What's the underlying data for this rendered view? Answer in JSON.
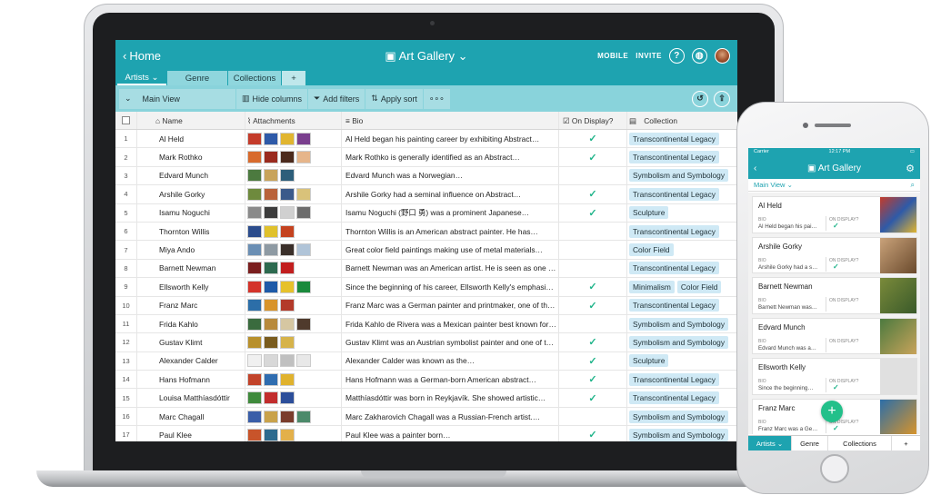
{
  "desktop": {
    "home_label": "Home",
    "app_title": "Art Gallery",
    "mobile_label": "MOBILE",
    "invite_label": "INVITE",
    "tabs": [
      "Artists",
      "Genre",
      "Collections"
    ],
    "toolbar": {
      "view_label": "Main View",
      "hide_columns": "Hide columns",
      "add_filters": "Add filters",
      "apply_sort": "Apply sort"
    },
    "columns": [
      "Name",
      "Attachments",
      "Bio",
      "On Display?",
      "Collection"
    ],
    "rows": [
      {
        "n": "1",
        "name": "Al Held",
        "bio": "Al Held began his painting career by exhibiting Abstract…",
        "on": true,
        "tags": [
          "Transcontinental Legacy"
        ]
      },
      {
        "n": "2",
        "name": "Mark Rothko",
        "bio": "Mark Rothko is generally identified as an Abstract…",
        "on": true,
        "tags": [
          "Transcontinental Legacy"
        ]
      },
      {
        "n": "3",
        "name": "Edvard Munch",
        "bio": "Edvard Munch was a Norwegian…",
        "on": false,
        "tags": [
          "Symbolism and Symbology"
        ]
      },
      {
        "n": "4",
        "name": "Arshile Gorky",
        "bio": "Arshile Gorky had a seminal influence on Abstract…",
        "on": true,
        "tags": [
          "Transcontinental Legacy"
        ]
      },
      {
        "n": "5",
        "name": "Isamu Noguchi",
        "bio": "Isamu Noguchi (野口 勇) was a prominent Japanese…",
        "on": true,
        "tags": [
          "Sculpture"
        ]
      },
      {
        "n": "6",
        "name": "Thornton Willis",
        "bio": "Thornton Willis is an American abstract painter. He has…",
        "on": false,
        "tags": [
          "Transcontinental Legacy"
        ]
      },
      {
        "n": "7",
        "name": "Miya Ando",
        "bio": "Great color field paintings making use of metal materials…",
        "on": false,
        "tags": [
          "Color Field"
        ]
      },
      {
        "n": "8",
        "name": "Barnett Newman",
        "bio": "Barnett Newman was an American artist. He is seen as one …",
        "on": false,
        "tags": [
          "Transcontinental Legacy"
        ]
      },
      {
        "n": "9",
        "name": "Ellsworth Kelly",
        "bio": "Since the beginning of his career, Ellsworth Kelly's emphasi…",
        "on": true,
        "tags": [
          "Minimalism",
          "Color Field"
        ]
      },
      {
        "n": "10",
        "name": "Franz Marc",
        "bio": "Franz Marc was a German painter and printmaker, one of th…",
        "on": true,
        "tags": [
          "Transcontinental Legacy"
        ]
      },
      {
        "n": "11",
        "name": "Frida Kahlo",
        "bio": "Frida Kahlo de Rivera was a Mexican painter best known for…",
        "on": false,
        "tags": [
          "Symbolism and Symbology"
        ]
      },
      {
        "n": "12",
        "name": "Gustav Klimt",
        "bio": "Gustav Klimt was an Austrian symbolist painter and one of t…",
        "on": true,
        "tags": [
          "Symbolism and Symbology"
        ]
      },
      {
        "n": "13",
        "name": "Alexander Calder",
        "bio": "Alexander Calder was known as the…",
        "on": true,
        "tags": [
          "Sculpture"
        ]
      },
      {
        "n": "14",
        "name": "Hans Hofmann",
        "bio": "Hans Hofmann was a German-born American abstract…",
        "on": true,
        "tags": [
          "Transcontinental Legacy"
        ]
      },
      {
        "n": "15",
        "name": "Louisa Matthíasdóttir",
        "bio": "Matthíasdóttir was born in Reykjavík. She showed artistic…",
        "on": true,
        "tags": [
          "Transcontinental Legacy"
        ]
      },
      {
        "n": "16",
        "name": "Marc Chagall",
        "bio": "Marc Zakharovich Chagall was a Russian-French artist.…",
        "on": false,
        "tags": [
          "Symbolism and Symbology"
        ]
      },
      {
        "n": "17",
        "name": "Paul Klee",
        "bio": "Paul Klee was a painter born…",
        "on": true,
        "tags": [
          "Symbolism and Symbology"
        ]
      }
    ]
  },
  "mobile": {
    "carrier": "Carrier",
    "time": "12:17 PM",
    "app_title": "Art Gallery",
    "view_label": "Main View",
    "bio_label": "BIO",
    "display_label": "ON DISPLAY?",
    "cards": [
      {
        "name": "Al Held",
        "bio": "Al Held began his pai…",
        "on": true
      },
      {
        "name": "Arshile Gorky",
        "bio": "Arshile Gorky had a s…",
        "on": true
      },
      {
        "name": "Barnett Newman",
        "bio": "Barnett Newman was…",
        "on": false
      },
      {
        "name": "Edvard Munch",
        "bio": "Edvard Munch was a…",
        "on": false
      },
      {
        "name": "Ellsworth Kelly",
        "bio": "Since the beginning…",
        "on": true
      },
      {
        "name": "Franz Marc",
        "bio": "Franz Marc was a Ge…",
        "on": true
      }
    ],
    "tabs": [
      "Artists",
      "Genre",
      "Collections"
    ]
  },
  "colors": {
    "teal": "#1ea3b0",
    "light_teal": "#89d3db",
    "check_green": "#20b48a",
    "tag_bg": "#cfe9f5",
    "fab_green": "#22c08a"
  }
}
